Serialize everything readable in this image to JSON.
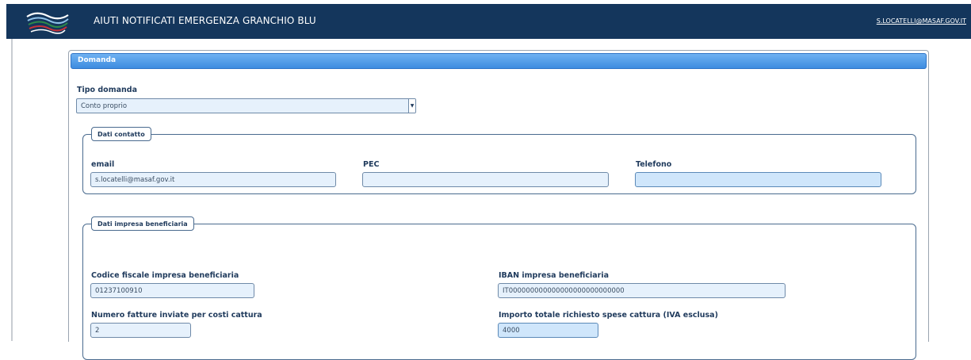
{
  "header": {
    "title": "AIUTI NOTIFICATI EMERGENZA GRANCHIO BLU",
    "user": "S.LOCATELLI@MASAF.GOV.IT",
    "logo_icon": "crab-wave-logo-icon"
  },
  "colors": {
    "header_bg": "#14365c",
    "panel_header": "#4a97e8",
    "field_bg": "#e6f1fc"
  },
  "domanda": {
    "panel_title": "Domanda",
    "tipo_label": "Tipo domanda",
    "tipo_value": "Conto proprio",
    "dropdown_icon": "chevron-down-icon"
  },
  "contatto": {
    "legend": "Dati contatto",
    "email_label": "email",
    "email_value": "s.locatelli@masaf.gov.it",
    "pec_label": "PEC",
    "pec_value": "",
    "telefono_label": "Telefono",
    "telefono_value": ""
  },
  "impresa": {
    "legend": "Dati impresa beneficiaria",
    "cf_label": "Codice fiscale impresa beneficiaria",
    "cf_value": "01237100910",
    "iban_label": "IBAN impresa beneficiaria",
    "iban_value": "IT000000000000000000000000000",
    "fatture_label": "Numero fatture inviate per costi cattura",
    "fatture_value": "2",
    "importo_label": "Importo totale richiesto spese cattura (IVA esclusa)",
    "importo_value": "4000"
  }
}
